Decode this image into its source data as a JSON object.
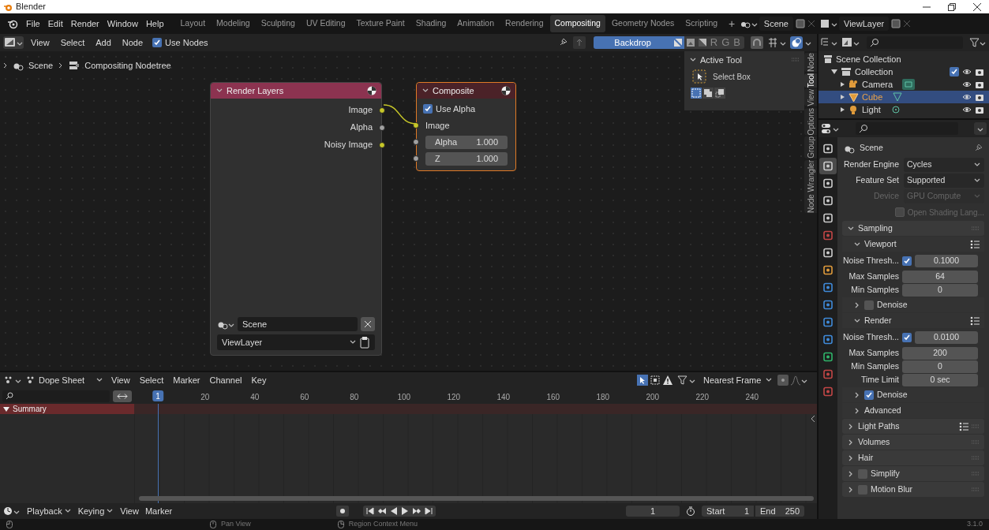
{
  "window": {
    "title": "Blender"
  },
  "menu": [
    "File",
    "Edit",
    "Render",
    "Window",
    "Help"
  ],
  "workspaces": [
    {
      "label": "Layout",
      "selected": false
    },
    {
      "label": "Modeling",
      "selected": false
    },
    {
      "label": "Sculpting",
      "selected": false
    },
    {
      "label": "UV Editing",
      "selected": false
    },
    {
      "label": "Texture Paint",
      "selected": false
    },
    {
      "label": "Shading",
      "selected": false
    },
    {
      "label": "Animation",
      "selected": false
    },
    {
      "label": "Rendering",
      "selected": false
    },
    {
      "label": "Compositing",
      "selected": true
    },
    {
      "label": "Geometry Nodes",
      "selected": false
    },
    {
      "label": "Scripting",
      "selected": false
    }
  ],
  "add_workspace": "+",
  "scene": "Scene",
  "view_layer": "ViewLayer",
  "node_editor": {
    "menus": [
      "View",
      "Select",
      "Add",
      "Node"
    ],
    "use_nodes": {
      "label": "Use Nodes",
      "checked": true
    },
    "backdrop": {
      "label": "Backdrop",
      "on": true
    },
    "channels": [
      {
        "label": "R",
        "selected": false
      },
      {
        "label": "G",
        "selected": false
      },
      {
        "label": "B",
        "selected": false
      }
    ],
    "breadcrumb": [
      "Scene",
      "Compositing Nodetree"
    ],
    "nodes": [
      {
        "kind": "render_layers",
        "title": "Render Layers",
        "sockets": [
          {
            "label": "Image",
            "color": "#c7c729"
          },
          {
            "label": "Alpha",
            "color": "#a1a1a1"
          },
          {
            "label": "Noisy Image",
            "color": "#c7c729"
          }
        ],
        "scene": "Scene",
        "view_layer": "ViewLayer"
      },
      {
        "kind": "composite",
        "title": "Composite",
        "use_alpha": {
          "label": "Use Alpha",
          "checked": true
        },
        "sockets": [
          {
            "label": "Image",
            "color": "#c7c729"
          },
          {
            "label": "Alpha",
            "color": "#a1a1a1",
            "value": "1.000"
          },
          {
            "label": "Z",
            "color": "#a1a1a1",
            "value": "1.000"
          }
        ]
      }
    ],
    "sidebar": {
      "title": "Active Tool",
      "tool": "Select Box",
      "tabs": [
        {
          "label": "Node",
          "selected": false
        },
        {
          "label": "Tool",
          "selected": true
        },
        {
          "label": "View",
          "selected": false
        },
        {
          "label": "Options",
          "selected": false
        },
        {
          "label": "Group",
          "selected": false
        },
        {
          "label": "Node Wrangler",
          "selected": false
        }
      ]
    }
  },
  "outliner": {
    "items": [
      {
        "label": "Scene Collection",
        "selected": false,
        "children": [
          {
            "label": "Collection",
            "selected": false,
            "checked": true,
            "children": [
              {
                "label": "Camera",
                "selected": false
              },
              {
                "label": "Cube",
                "selected": true
              },
              {
                "label": "Light",
                "selected": false
              }
            ]
          }
        ]
      }
    ]
  },
  "properties": {
    "tabs": [
      {
        "selected": false
      },
      {
        "selected": true
      },
      {
        "selected": false
      },
      {
        "selected": false
      },
      {
        "selected": false
      },
      {
        "selected": false
      },
      {
        "selected": false
      },
      {
        "selected": false
      },
      {
        "selected": false
      },
      {
        "selected": false
      },
      {
        "selected": false
      },
      {
        "selected": false
      },
      {
        "selected": false
      },
      {
        "selected": false
      },
      {
        "selected": false
      }
    ],
    "context": "Scene",
    "items": [
      {
        "kind": "dropdown",
        "label": "Render Engine",
        "value": "Cycles",
        "disabled": false
      },
      {
        "kind": "dropdown",
        "label": "Feature Set",
        "value": "Supported",
        "disabled": false
      },
      {
        "kind": "dropdown",
        "label": "Device",
        "value": "GPU Compute",
        "disabled": true
      },
      {
        "kind": "checkbox",
        "label": "Open Shading Lang...",
        "checked": false,
        "disabled": true
      },
      {
        "kind": "panel",
        "label": "Sampling",
        "expanded": true
      },
      {
        "kind": "subpanel",
        "label": "Viewport",
        "expanded": true,
        "presets": true
      },
      {
        "kind": "check_number",
        "label": "Noise Thresh...",
        "checked": true,
        "value": "0.1000"
      },
      {
        "kind": "number",
        "label": "Max Samples",
        "value": "64"
      },
      {
        "kind": "number",
        "label": "Min Samples",
        "value": "0"
      },
      {
        "kind": "subpanel",
        "label": "Denoise",
        "expanded": false,
        "checked": false
      },
      {
        "kind": "subpanel",
        "label": "Render",
        "expanded": true,
        "presets": true
      },
      {
        "kind": "check_number",
        "label": "Noise Thresh...",
        "checked": true,
        "value": "0.0100"
      },
      {
        "kind": "number",
        "label": "Max Samples",
        "value": "200"
      },
      {
        "kind": "number",
        "label": "Min Samples",
        "value": "0"
      },
      {
        "kind": "number",
        "label": "Time Limit",
        "value": "0 sec"
      },
      {
        "kind": "subpanel",
        "label": "Denoise",
        "expanded": false,
        "checked": true
      },
      {
        "kind": "subpanel",
        "label": "Advanced",
        "expanded": false
      },
      {
        "kind": "panel",
        "label": "Light Paths",
        "expanded": false,
        "presets": true
      },
      {
        "kind": "panel",
        "label": "Volumes",
        "expanded": false
      },
      {
        "kind": "panel",
        "label": "Hair",
        "expanded": false
      },
      {
        "kind": "panel",
        "label": "Simplify",
        "expanded": false,
        "checked": false
      },
      {
        "kind": "panel",
        "label": "Motion Blur",
        "expanded": false,
        "checked": false
      }
    ]
  },
  "dope_sheet": {
    "mode": "Dope Sheet",
    "menus": [
      "View",
      "Select",
      "Marker",
      "Channel",
      "Key"
    ],
    "snap": "Nearest Frame",
    "current_frame": "1",
    "ticks": [
      "20",
      "40",
      "60",
      "80",
      "100",
      "120",
      "140",
      "160",
      "180",
      "200",
      "220",
      "240"
    ],
    "channels": [
      {
        "label": "Summary",
        "expanded": true
      }
    ]
  },
  "timeline": {
    "menus": [
      "Playback",
      "Keying",
      "View",
      "Marker"
    ],
    "frame": "1",
    "start_label": "Start",
    "start": "1",
    "end_label": "End",
    "end": "250"
  },
  "status_bar": {
    "hints": [
      "Pan View",
      "Region Context Menu"
    ],
    "version": "3.1.0"
  }
}
